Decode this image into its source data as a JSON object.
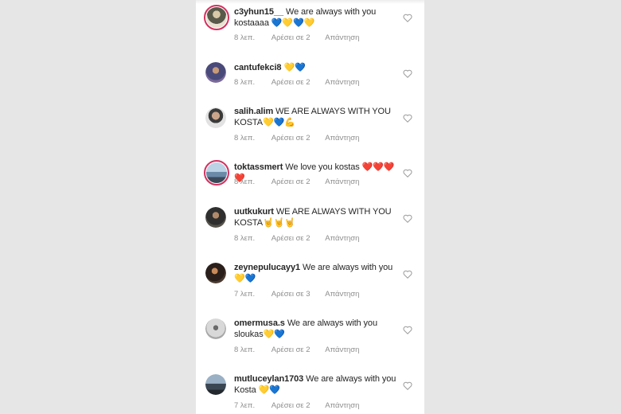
{
  "comments": [
    {
      "username": "c3yhun15__",
      "text": "We are always with you kostaaaa 💙💛💙💛",
      "time": "8 λεπ.",
      "likes": "Αρέσει σε 2",
      "reply": "Απάντηση",
      "story_ring": true
    },
    {
      "username": "cantufekci8",
      "text": "💛💙",
      "time": "8 λεπ.",
      "likes": "Αρέσει σε 2",
      "reply": "Απάντηση",
      "story_ring": false
    },
    {
      "username": "salih.alim",
      "text": "WE ARE ALWAYS WITH YOU KOSTA💛💙💪",
      "time": "8 λεπ.",
      "likes": "Αρέσει σε 2",
      "reply": "Απάντηση",
      "story_ring": false
    },
    {
      "username": "toktassmert",
      "text": "We love you kostas ❤️❤️❤️❤️",
      "time": "8 λεπ.",
      "likes": "Αρέσει σε 2",
      "reply": "Απάντηση",
      "story_ring": true
    },
    {
      "username": "uutkukurt",
      "text": "WE ARE ALWAYS WITH YOU KOSTA🤘🤘🤘",
      "time": "8 λεπ.",
      "likes": "Αρέσει σε 2",
      "reply": "Απάντηση",
      "story_ring": false
    },
    {
      "username": "zeynepulucayy1",
      "text": "We are always with you 💛💙",
      "time": "7 λεπ.",
      "likes": "Αρέσει σε 3",
      "reply": "Απάντηση",
      "story_ring": false
    },
    {
      "username": "omermusa.s",
      "text": "We are always with you sloukas💛💙",
      "time": "8 λεπ.",
      "likes": "Αρέσει σε 2",
      "reply": "Απάντηση",
      "story_ring": false
    },
    {
      "username": "mutluceylan1703",
      "text": "We are always with you Kosta 💛💙",
      "time": "7 λεπ.",
      "likes": "Αρέσει σε 2",
      "reply": "Απάντηση",
      "story_ring": false
    }
  ],
  "colors": {
    "background": "#e6e6e6",
    "panel": "#ffffff",
    "text": "#262626",
    "meta": "#8e8e8e",
    "story_ring": "#d3315f",
    "heart_outline": "#9a9a9a"
  },
  "icons": {
    "like": "heart-outline-icon"
  }
}
